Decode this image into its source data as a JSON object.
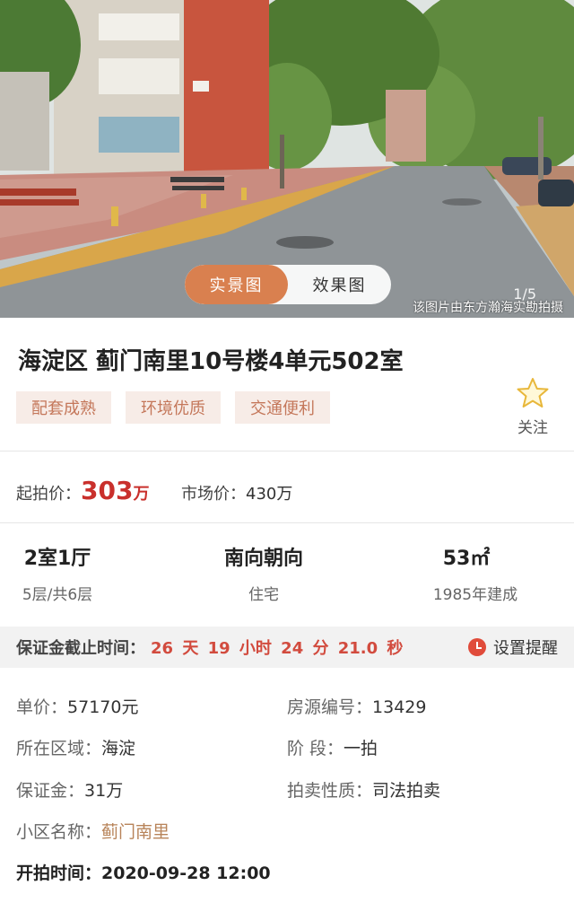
{
  "gallery": {
    "tabs": [
      {
        "label": "实景图",
        "active": true
      },
      {
        "label": "效果图",
        "active": false
      }
    ],
    "pager": "1/5",
    "credit": "该图片由东方瀚海实勘拍摄"
  },
  "listing": {
    "title": "海淀区 蓟门南里10号楼4单元502室",
    "tags": [
      "配套成熟",
      "环境优质",
      "交通便利"
    ],
    "follow_label": "关注"
  },
  "price": {
    "start_label": "起拍价：",
    "start_value": "303",
    "start_unit": "万",
    "market_label": "市场价：",
    "market_value": "430万"
  },
  "stats": [
    {
      "main": "2室1厅",
      "sub": "5层/共6层"
    },
    {
      "main": "南向朝向",
      "sub": "住宅"
    },
    {
      "main": "53㎡",
      "sub": "1985年建成"
    }
  ],
  "deposit": {
    "label": "保证金截止时间：",
    "countdown": "26 天 19 小时 24 分 21.0  秒",
    "remind_label": "设置提醒"
  },
  "details": {
    "unit_price_label": "单价：",
    "unit_price": "57170元",
    "listing_no_label": "房源编号：",
    "listing_no": "13429",
    "district_label": "所在区域：",
    "district": "海淀",
    "stage_label": "阶 段：",
    "stage": "一拍",
    "deposit_label": "保证金：",
    "deposit": "31万",
    "auction_type_label": "拍卖性质：",
    "auction_type": "司法拍卖",
    "community_label": "小区名称：",
    "community": "蓟门南里",
    "start_time_label": "开拍时间：",
    "start_time": "2020-09-28 12:00"
  },
  "colors": {
    "accent": "#d9804f",
    "price_red": "#c9302c",
    "countdown_red": "#d24b3e",
    "tag_bg": "#f7ece7",
    "tag_text": "#c4775a",
    "link": "#b8845a"
  },
  "icons": {
    "follow": "star-outline-icon",
    "remind": "clock-icon"
  }
}
